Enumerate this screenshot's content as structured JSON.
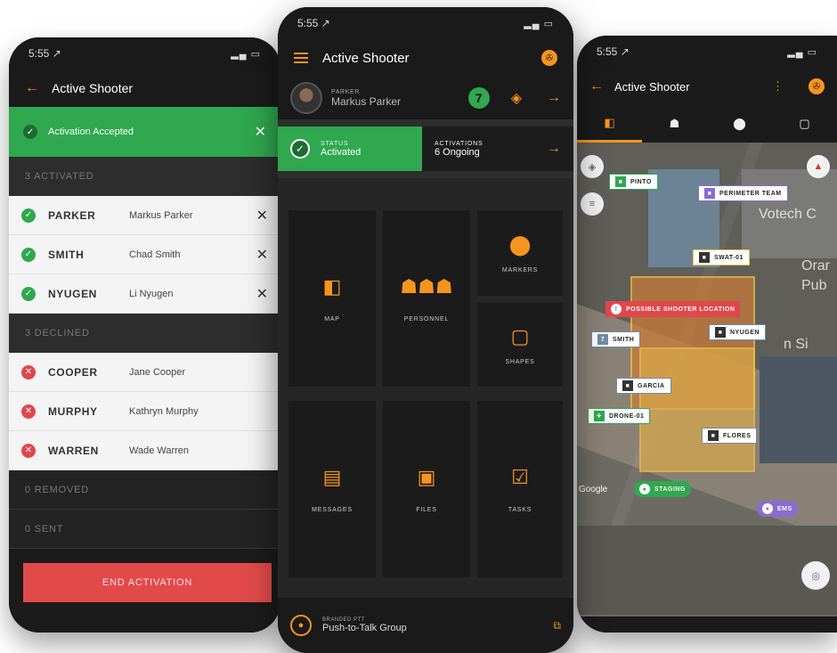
{
  "left_phone": {
    "time": "5:55 ↗",
    "signal": "▂▄ ▭",
    "title": "Active Shooter",
    "banner": "Activation Accepted",
    "activated_header": "3 ACTIVATED",
    "activated": [
      {
        "last": "PARKER",
        "full": "Markus Parker"
      },
      {
        "last": "SMITH",
        "full": "Chad Smith"
      },
      {
        "last": "NYUGEN",
        "full": "Li Nyugen"
      }
    ],
    "declined_header": "3 DECLINED",
    "declined": [
      {
        "last": "COOPER",
        "full": "Jane Cooper"
      },
      {
        "last": "MURPHY",
        "full": "Kathryn Murphy"
      },
      {
        "last": "WARREN",
        "full": "Wade Warren"
      }
    ],
    "removed_header": "0 REMOVED",
    "sent_header": "0 SENT",
    "end_button": "END ACTIVATION"
  },
  "center_phone": {
    "time": "5:55 ↗",
    "signal": "▂▄ ▭",
    "title": "Active Shooter",
    "user_role": "PARKER",
    "user_name": "Markus Parker",
    "ptt_badge": "7",
    "status_label": "STATUS",
    "status_value": "Activated",
    "activations_label": "ACTIVATIONS",
    "activations_value": "6 Ongoing",
    "tiles": {
      "map": "MAP",
      "personnel": "PERSONNEL",
      "markers": "MARKERS",
      "shapes": "SHAPES",
      "messages": "MESSAGES",
      "files": "FILES",
      "tasks": "TASKS"
    },
    "ptt_label": "BRANDED PTT",
    "ptt_group": "Push-to-Talk Group"
  },
  "right_phone": {
    "time": "5:55 ↗",
    "signal": "▂▄ ▭",
    "title": "Active Shooter",
    "map_texts": [
      "Votech C",
      "Orar",
      "Pub",
      "n Si"
    ],
    "tags": {
      "pinto": "PINTO",
      "perimeter": "PERIMETER TEAM",
      "swat": "SWAT-01",
      "possible": "POSSIBLE SHOOTER LOCATION",
      "smith": "SMITH",
      "nyugen": "NYUGEN",
      "garcia": "GARCIA",
      "drone": "DRONE-01",
      "flores": "FLORES",
      "staging": "STAGING",
      "ems": "EMS"
    },
    "google": "Google"
  },
  "colors": {
    "accent_orange": "#f7941d",
    "success_green": "#2fa84f",
    "danger_red": "#e24a4a",
    "dark_bg": "#1b1b1b"
  }
}
